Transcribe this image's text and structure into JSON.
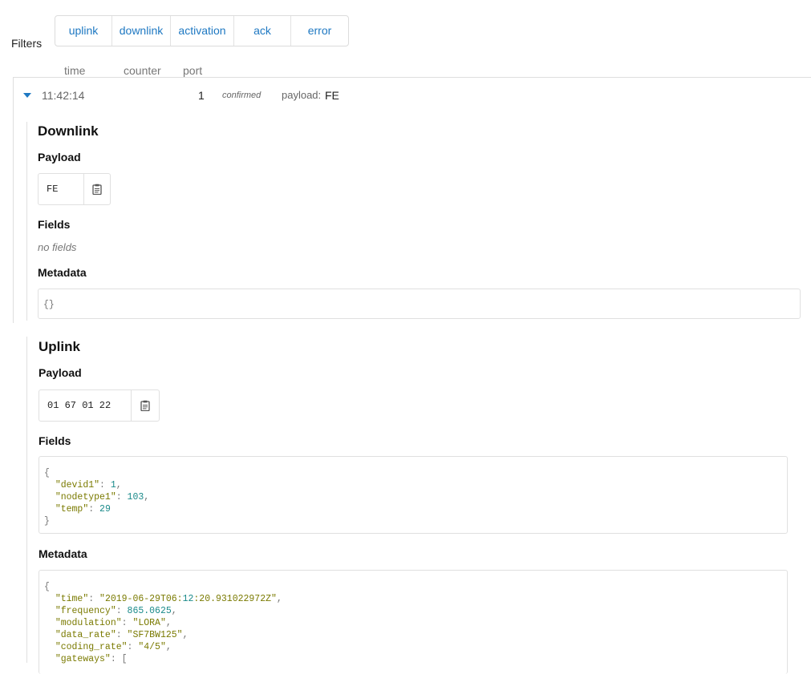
{
  "filters": {
    "label": "Filters",
    "items": [
      "uplink",
      "downlink",
      "activation",
      "ack",
      "error"
    ]
  },
  "columns": {
    "time": "time",
    "counter": "counter",
    "port": "port"
  },
  "row": {
    "time": "11:42:14",
    "port": "1",
    "confirmed": "confirmed",
    "payload_label": "payload:",
    "payload_value": "FE"
  },
  "downlink": {
    "title": "Downlink",
    "payload_heading": "Payload",
    "payload": "FE",
    "fields_heading": "Fields",
    "fields_empty": "no fields",
    "metadata_heading": "Metadata",
    "metadata": "{}"
  },
  "uplink": {
    "title": "Uplink",
    "payload_heading": "Payload",
    "payload": "01 67 01 22",
    "fields_heading": "Fields",
    "fields_lines": [
      "{",
      "  \"devid1\": 1,",
      "  \"nodetype1\": 103,",
      "  \"temp\": 29",
      "}"
    ],
    "metadata_heading": "Metadata",
    "metadata_lines": [
      "{",
      "  \"time\": \"2019-06-29T06:12:20.931022972Z\",",
      "  \"frequency\": 865.0625,",
      "  \"modulation\": \"LORA\",",
      "  \"data_rate\": \"SF7BW125\",",
      "  \"coding_rate\": \"4/5\",",
      "  \"gateways\": ["
    ]
  },
  "colors": {
    "accent": "#1e78c2",
    "key": "#7a7a00",
    "number": "#1a8a8a"
  },
  "icons": {
    "expand": "caret-down-icon",
    "copy": "clipboard-icon"
  }
}
